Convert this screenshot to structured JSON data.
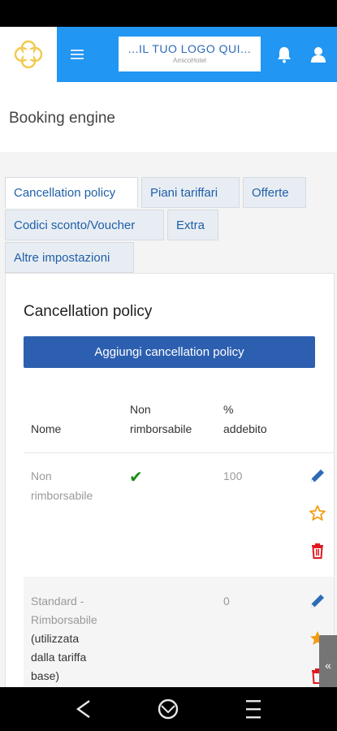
{
  "header": {
    "logo_title": "...IL TUO LOGO QUI...",
    "logo_subtitle": "AmicoHotel"
  },
  "page": {
    "title": "Booking engine"
  },
  "tabs": [
    {
      "label": "Cancellation policy",
      "active": true
    },
    {
      "label": "Piani tariffari",
      "active": false
    },
    {
      "label": "Offerte",
      "active": false
    },
    {
      "label": "Codici sconto/Voucher",
      "active": false
    },
    {
      "label": "Extra",
      "active": false
    },
    {
      "label": "Altre impostazioni",
      "active": false
    }
  ],
  "section": {
    "title": "Cancellation policy",
    "add_button": "Aggiungi cancellation policy"
  },
  "table": {
    "headers": {
      "name": "Nome",
      "non_refundable_1": "Non",
      "non_refundable_2": "rimborsabile",
      "charge_1": "%",
      "charge_2": "addebito"
    },
    "rows": [
      {
        "name_1": "Non",
        "name_2": "rimborsabile",
        "non_refundable": true,
        "charge": "100",
        "default": false
      },
      {
        "name_1": "Standard -",
        "name_2": "Rimborsabile",
        "note_1": "(utilizzata",
        "note_2": "dalla tariffa",
        "note_3": "base)",
        "non_refundable": false,
        "charge": "0",
        "default": true
      }
    ]
  },
  "colors": {
    "primary": "#2196f3",
    "button": "#2d5fb0",
    "edit_icon": "#2d6bb5",
    "star_icon": "#f39c12",
    "delete_icon": "#e0191f",
    "check": "#1a8c1a"
  },
  "side_handle": "«"
}
